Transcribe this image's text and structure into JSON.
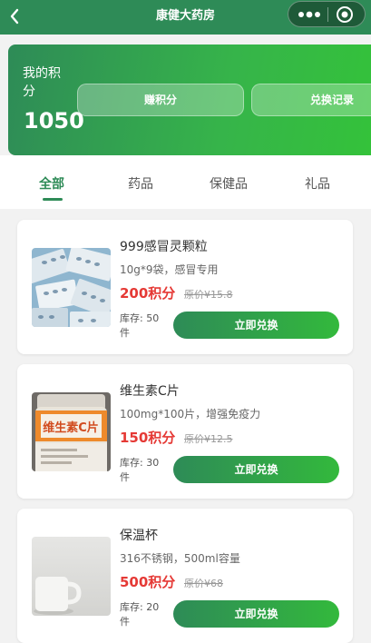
{
  "nav": {
    "title": "康健大药房",
    "back_icon": "chevron-left-icon",
    "more_icon": "more-dots-icon",
    "close_icon": "target-circle-icon"
  },
  "points": {
    "label": "我的积分",
    "value": "1050",
    "earn_label": "赚积分",
    "history_label": "兑换记录"
  },
  "tabs": [
    {
      "label": "全部",
      "active": true
    },
    {
      "label": "药品",
      "active": false
    },
    {
      "label": "保健品",
      "active": false
    },
    {
      "label": "礼品",
      "active": false
    }
  ],
  "products": [
    {
      "name": "999感冒灵颗粒",
      "desc": "10g*9袋，感冒专用",
      "points": "200积分",
      "original": "原价¥15.8",
      "stock": "库存: 50件",
      "button": "立即兑换",
      "image": "medicine-blister-packs"
    },
    {
      "name": "维生素C片",
      "desc": "100mg*100片，增强免疫力",
      "points": "150积分",
      "original": "原价¥12.5",
      "stock": "库存: 30件",
      "button": "立即兑换",
      "image": "vitamin-c-bottle",
      "image_text": "维生素C片"
    },
    {
      "name": "保温杯",
      "desc": "316不锈钢，500ml容量",
      "points": "500积分",
      "original": "原价¥68",
      "stock": "库存: 20件",
      "button": "立即兑换",
      "image": "white-mug"
    }
  ],
  "colors": {
    "brand": "#2e8b57",
    "accent": "#34c23a",
    "price": "#e53935"
  }
}
